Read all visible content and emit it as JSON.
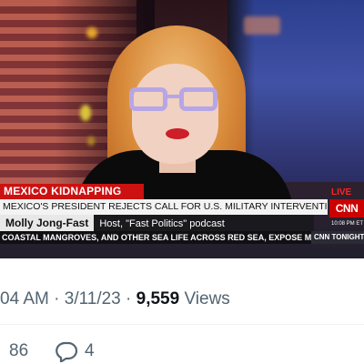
{
  "tv": {
    "category_tag": "MEXICO KIDNAPPING",
    "headline": "MEXICO'S PRESIDENT REJECTS CALL FOR U.S. MILITARY INTERVENTION IN MEXICO",
    "guest_name": "Molly Jong-Fast",
    "guest_role": "Host, \"Fast Politics\" podcast",
    "ticker": "COASTAL MANGROVES, AND OTHER SEA LIFE ACROSS RED SEA, EXPOSE MILI",
    "live_label": "LIVE",
    "network_logo": "CNN",
    "clock": "10:08 PM ET",
    "ticker_right": "CNN TONIGHT"
  },
  "tweet": {
    "time": "04 AM",
    "separator": "·",
    "date": "3/11/23",
    "views_count": "9,559",
    "views_label": "Views",
    "retweets": "86",
    "replies": "4"
  },
  "icons": {
    "reply": "speech-bubble-icon"
  },
  "colors": {
    "cnn_red": "#cc0000",
    "secondary_text": "#536471",
    "primary_text": "#0f1419"
  }
}
